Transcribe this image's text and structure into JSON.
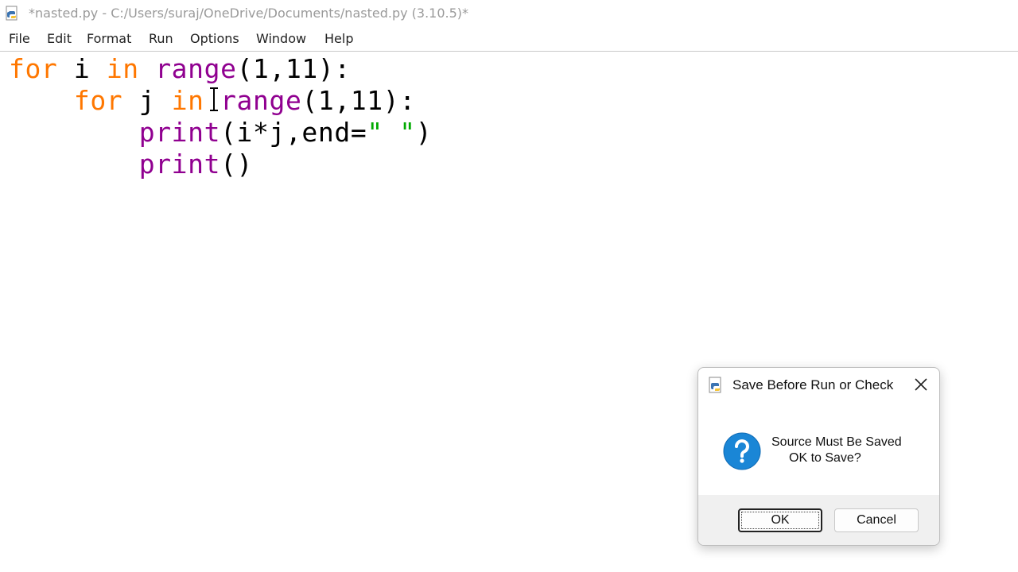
{
  "window": {
    "title": "*nasted.py - C:/Users/suraj/OneDrive/Documents/nasted.py (3.10.5)*"
  },
  "menu": {
    "items": [
      "File",
      "Edit",
      "Format",
      "Run",
      "Options",
      "Window",
      "Help"
    ]
  },
  "editor": {
    "lines": [
      [
        {
          "t": "for",
          "c": "kw"
        },
        {
          "t": " i ",
          "c": "plain"
        },
        {
          "t": "in",
          "c": "kw"
        },
        {
          "t": " ",
          "c": "plain"
        },
        {
          "t": "range",
          "c": "builtin"
        },
        {
          "t": "(1,11):",
          "c": "plain"
        }
      ],
      [
        {
          "t": "    ",
          "c": "plain"
        },
        {
          "t": "for",
          "c": "kw"
        },
        {
          "t": " j ",
          "c": "plain"
        },
        {
          "t": "in",
          "c": "kw"
        },
        {
          "t": " ",
          "c": "plain"
        },
        {
          "t": "range",
          "c": "builtin"
        },
        {
          "t": "(1,11):",
          "c": "plain"
        }
      ],
      [
        {
          "t": "        ",
          "c": "plain"
        },
        {
          "t": "print",
          "c": "builtin"
        },
        {
          "t": "(i*j,end=",
          "c": "plain"
        },
        {
          "t": "\" \"",
          "c": "str"
        },
        {
          "t": ")",
          "c": "plain"
        }
      ],
      [
        {
          "t": "        ",
          "c": "plain"
        },
        {
          "t": "print",
          "c": "builtin"
        },
        {
          "t": "()",
          "c": "plain"
        }
      ]
    ]
  },
  "dialog": {
    "title": "Save Before Run or Check",
    "message_line1": "Source Must Be Saved",
    "message_line2": "OK to Save?",
    "ok_label": "OK",
    "cancel_label": "Cancel",
    "icon": "question-icon"
  },
  "colors": {
    "keyword": "#ff7700",
    "builtin": "#900090",
    "string": "#00aa00",
    "question_icon": "#1a86d6"
  }
}
